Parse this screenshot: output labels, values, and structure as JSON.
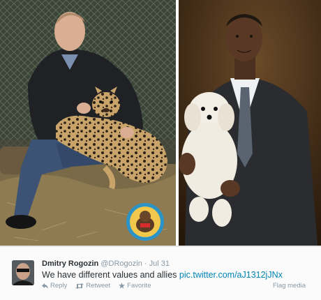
{
  "tweet": {
    "name": "Dmitry Rogozin",
    "handle": "@DRogozin",
    "separator": "·",
    "date": "Jul 31",
    "text": "We have different values and allies ",
    "link": "pic.twitter.com/aJ1312jJNx",
    "actions": {
      "reply": "Reply",
      "retweet": "Retweet",
      "favorite": "Favorite"
    },
    "flag": "Flag media"
  },
  "photos": {
    "left": {
      "subject": "man-with-leopard-cub"
    },
    "right": {
      "subject": "man-with-white-puppy"
    }
  },
  "colors": {
    "link": "#0084b4",
    "meta": "#8899a6",
    "text": "#292f33"
  }
}
